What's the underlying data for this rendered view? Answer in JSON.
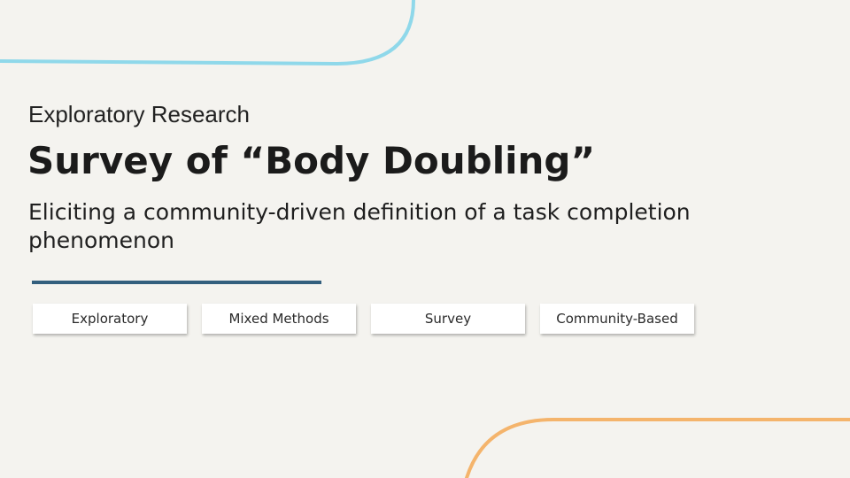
{
  "slide": {
    "kicker": "Exploratory Research",
    "title": "Survey of “Body Doubling”",
    "subtitle": "Eliciting a community-driven definition of a task completion phenomenon",
    "tags": [
      {
        "label": "Exploratory"
      },
      {
        "label": "Mixed Methods"
      },
      {
        "label": "Survey"
      },
      {
        "label": "Community-Based"
      }
    ]
  },
  "colors": {
    "background": "#f4f3ef",
    "accent_rule": "#335f7e",
    "arc_top": "#8fd8ea",
    "arc_bottom": "#f4b46c"
  }
}
